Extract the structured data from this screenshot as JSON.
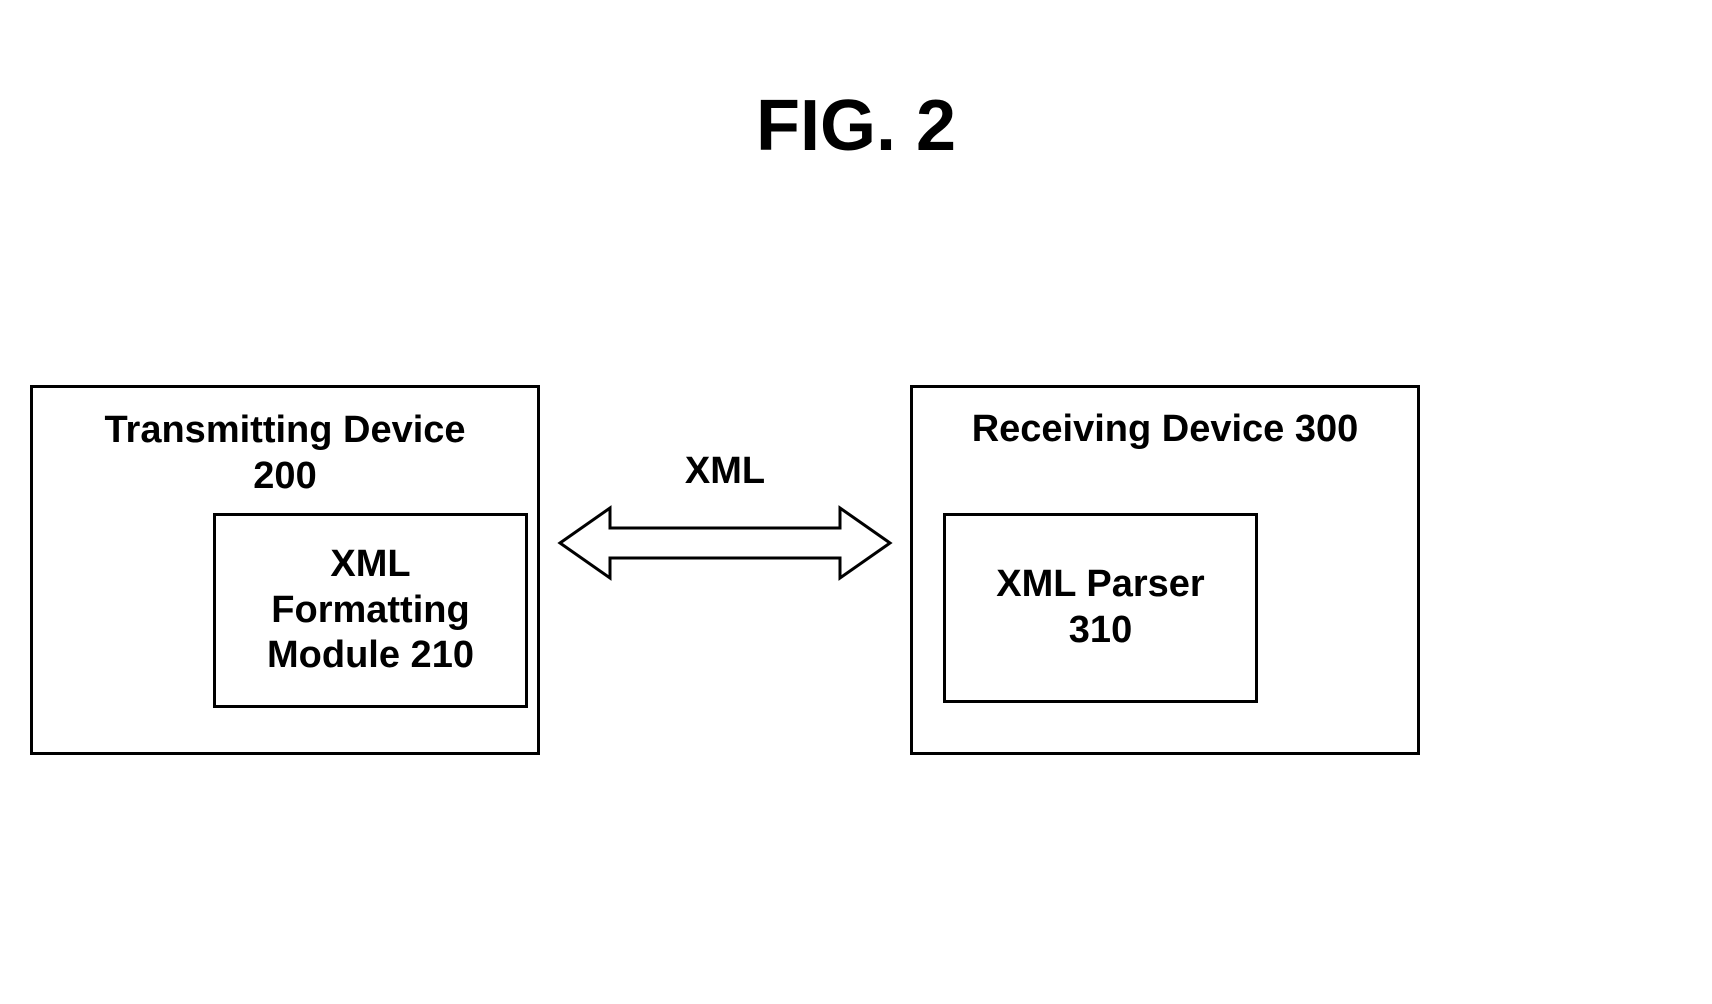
{
  "figure": {
    "title": "FIG. 2"
  },
  "transmitting": {
    "title_line1": "Transmitting Device",
    "title_line2": "200",
    "module_line1": "XML",
    "module_line2": "Formatting",
    "module_line3": "Module 210"
  },
  "receiving": {
    "title": "Receiving Device 300",
    "parser_line1": "XML Parser",
    "parser_line2": "310"
  },
  "connection": {
    "label": "XML"
  }
}
